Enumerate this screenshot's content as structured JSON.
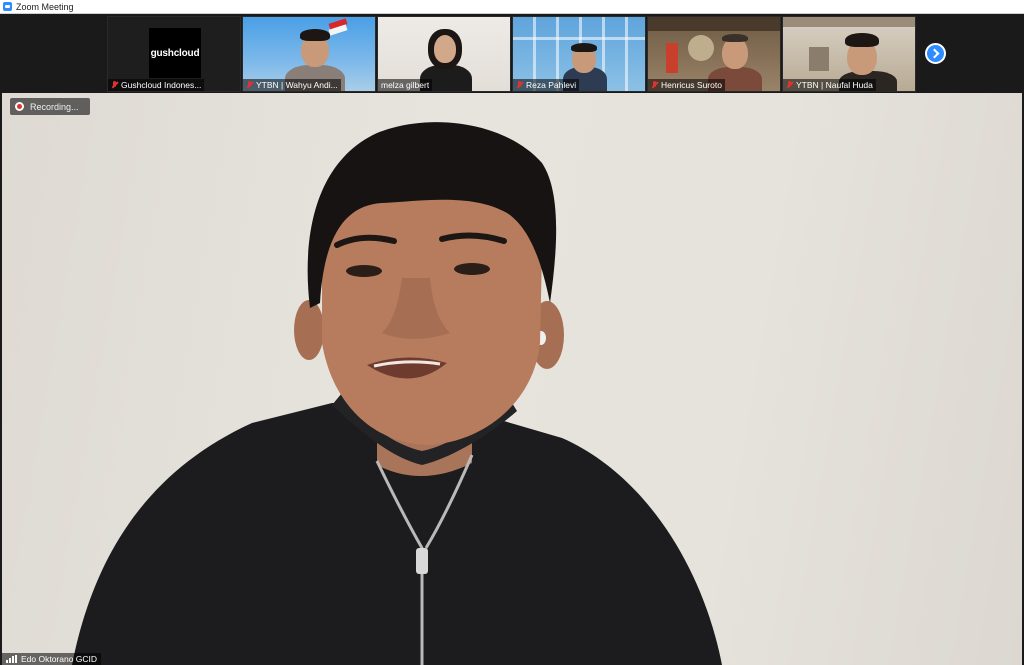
{
  "window": {
    "title": "Zoom Meeting",
    "app_icon": "zoom-camera-icon"
  },
  "gallery": {
    "participants": [
      {
        "name": "Gushcloud Indones...",
        "muted": true,
        "logo_text": "gushcloud"
      },
      {
        "name": "YTBN | Wahyu Andi...",
        "muted": true
      },
      {
        "name": "melza gilbert",
        "muted": false
      },
      {
        "name": "Reza Pahlevi",
        "muted": true
      },
      {
        "name": "Henricus Suroto",
        "muted": true
      },
      {
        "name": "YTBN | Naufal Huda",
        "muted": true
      }
    ],
    "next_page_icon": "chevron-right-icon"
  },
  "main_video": {
    "recording_label": "Recording...",
    "speaker_name": "Edo Oktorano GCID"
  },
  "colors": {
    "zoom_blue": "#2d8cff",
    "muted_red": "#e0322f",
    "background": "#1a1a1a"
  }
}
